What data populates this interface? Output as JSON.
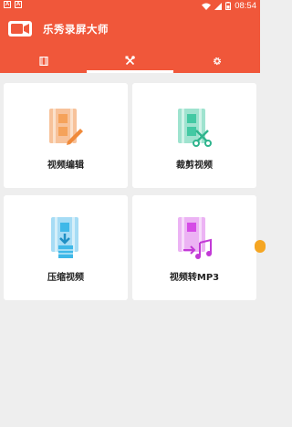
{
  "status_bar": {
    "left_icons": [
      "A",
      "A"
    ],
    "time": "08:54"
  },
  "app": {
    "title": "乐秀录屏大师",
    "accent_color": "#f0573a"
  },
  "tabs": [
    {
      "icon": "film-icon",
      "selected": false
    },
    {
      "icon": "tools-icon",
      "selected": true
    },
    {
      "icon": "gear-icon",
      "selected": false
    }
  ],
  "tools": [
    {
      "label": "视频编辑",
      "icon": "video-edit-icon",
      "color": "#f5a25a"
    },
    {
      "label": "裁剪视频",
      "icon": "video-crop-icon",
      "color": "#43c9a3"
    },
    {
      "label": "压缩视频",
      "icon": "video-compress-icon",
      "color": "#3fb8e8"
    },
    {
      "label": "视频转MP3",
      "icon": "video-to-mp3-icon",
      "color": "#d54be6"
    }
  ]
}
